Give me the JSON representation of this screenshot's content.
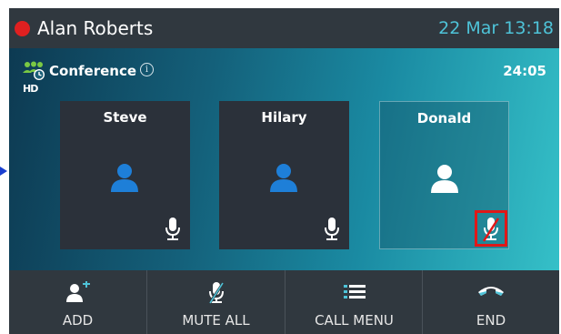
{
  "statusbar": {
    "caller_name": "Alan Roberts",
    "datetime": "22 Mar 13:18",
    "status_color": "#e02020"
  },
  "call": {
    "type_label": "Conference",
    "hd_label": "HD",
    "info_glyph": "i",
    "duration": "24:05"
  },
  "participants": [
    {
      "name": "Steve",
      "muted": false
    },
    {
      "name": "Hilary",
      "muted": false
    },
    {
      "name": "Donald",
      "muted": true
    }
  ],
  "softkeys": [
    {
      "label": "ADD",
      "icon": "add-participant-icon"
    },
    {
      "label": "MUTE ALL",
      "icon": "mute-all-icon"
    },
    {
      "label": "CALL MENU",
      "icon": "menu-list-icon"
    },
    {
      "label": "END",
      "icon": "end-call-icon"
    }
  ],
  "colors": {
    "accent": "#4ec3d8",
    "avatar_active": "#1e7fd8",
    "mute_highlight": "#e01818",
    "bar_bg": "#30383f"
  }
}
